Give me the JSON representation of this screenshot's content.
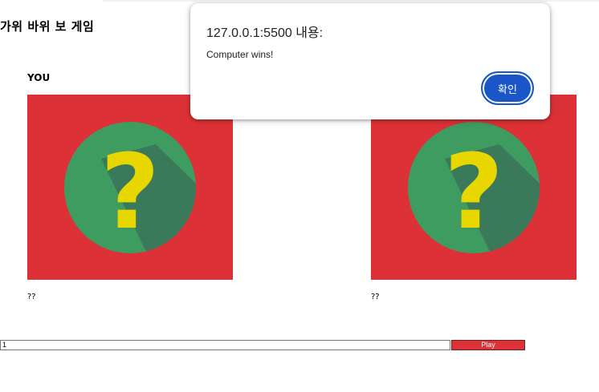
{
  "page": {
    "title": "가위 바위 보 게임"
  },
  "player": {
    "label": "YOU",
    "choice": "??",
    "image_icon": "question-mark-icon"
  },
  "computer": {
    "choice": "??",
    "image_icon": "question-mark-icon"
  },
  "controls": {
    "input_value": "1",
    "play_label": "Play"
  },
  "dialog": {
    "origin": "127.0.0.1:5500 내용:",
    "message": "Computer wins!",
    "ok_label": "확인"
  },
  "colors": {
    "card_background": "#dc3237",
    "circle": "#3e9c61",
    "question_mark": "#e8d600",
    "button_blue": "#1a56c9"
  }
}
